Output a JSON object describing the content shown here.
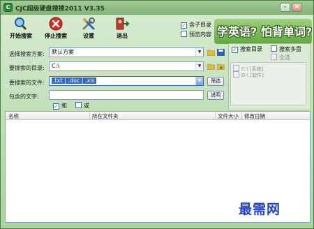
{
  "window": {
    "title": "CJC超级硬盘搜搜2011 V3.35",
    "minimize_glyph": "–",
    "close_glyph": "×"
  },
  "toolbar": {
    "start_label": "开始搜索",
    "stop_label": "停止搜索",
    "settings_label": "设置",
    "exit_label": "退出"
  },
  "options": {
    "include_subdirs": {
      "label": "含子目录",
      "checked": true
    },
    "preview_content": {
      "label": "预览内容",
      "checked": false
    }
  },
  "banner": {
    "text": "学英语? 怕背单词?"
  },
  "form": {
    "scheme": {
      "label": "选择搜索方案:",
      "value": "默认方案"
    },
    "directory": {
      "label": "要搜索的目录:",
      "value": "C:\\"
    },
    "files": {
      "label": "要搜索的文件:",
      "value": ".txt | .doc | .xls",
      "button": "筛选"
    },
    "contains": {
      "label": "包含的文字:",
      "value": "",
      "button": "说明"
    },
    "logic_and": {
      "label": "和",
      "checked": true
    },
    "logic_or": {
      "label": "或",
      "checked": false
    }
  },
  "right_panel": {
    "search_dirs": {
      "label": "搜索目录",
      "checked": true
    },
    "search_multi": {
      "label": "搜索多盘",
      "checked": false
    },
    "select_all": {
      "label": "全选",
      "checked": false
    },
    "drives": [
      "C:\\ [系统]",
      "D:\\ [软件]"
    ]
  },
  "results": {
    "columns": [
      "名称",
      "所在文件夹",
      "文件大小",
      "修改日期"
    ]
  },
  "watermark": "最需网",
  "colors": {
    "accent": "#316ac5",
    "banner_green": "#5faa3e",
    "watermark": "#2244c8"
  }
}
